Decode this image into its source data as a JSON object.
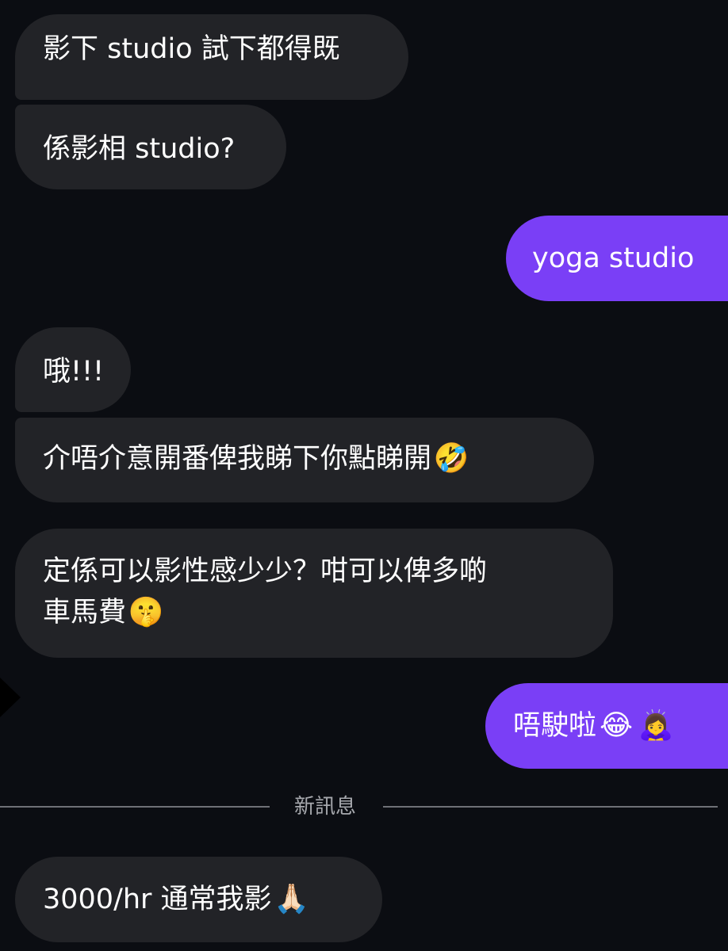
{
  "messages": [
    {
      "direction": "incoming",
      "lines": [
        "影下 studio 試下都得既"
      ]
    },
    {
      "direction": "incoming",
      "lines": [
        "係影相 studio?"
      ]
    },
    {
      "direction": "outgoing",
      "lines": [
        "yoga studio"
      ]
    },
    {
      "direction": "incoming",
      "lines": [
        "哦!!!"
      ]
    },
    {
      "direction": "incoming",
      "lines": [
        "介唔介意開番俾我睇下你點睇開"
      ],
      "emoji": "🤣",
      "emoji_name": "rofl-emoji"
    },
    {
      "direction": "incoming",
      "lines": [
        "定係可以影性感少少？咁可以俾多啲",
        "車馬費"
      ],
      "emoji": "🤫",
      "emoji_name": "shushing-face-emoji"
    },
    {
      "direction": "outgoing",
      "lines": [
        "唔駛啦"
      ],
      "emoji": "😂",
      "emoji2": "🙇‍♀️",
      "emoji_name": "tears-of-joy-emoji",
      "emoji2_name": "bowing-woman-emoji"
    },
    {
      "direction": "incoming",
      "lines": [
        "3000/hr 通常我影"
      ],
      "emoji": "🙏🏻",
      "emoji_name": "folded-hands-emoji"
    }
  ],
  "divider": {
    "label": "新訊息"
  },
  "colors": {
    "background": "#0b0d12",
    "incoming_bubble": "#222327",
    "outgoing_bubble": "#7a3ff6",
    "text": "#ffffff",
    "divider_text": "#a7a9ae",
    "divider_line": "#6e7076"
  }
}
